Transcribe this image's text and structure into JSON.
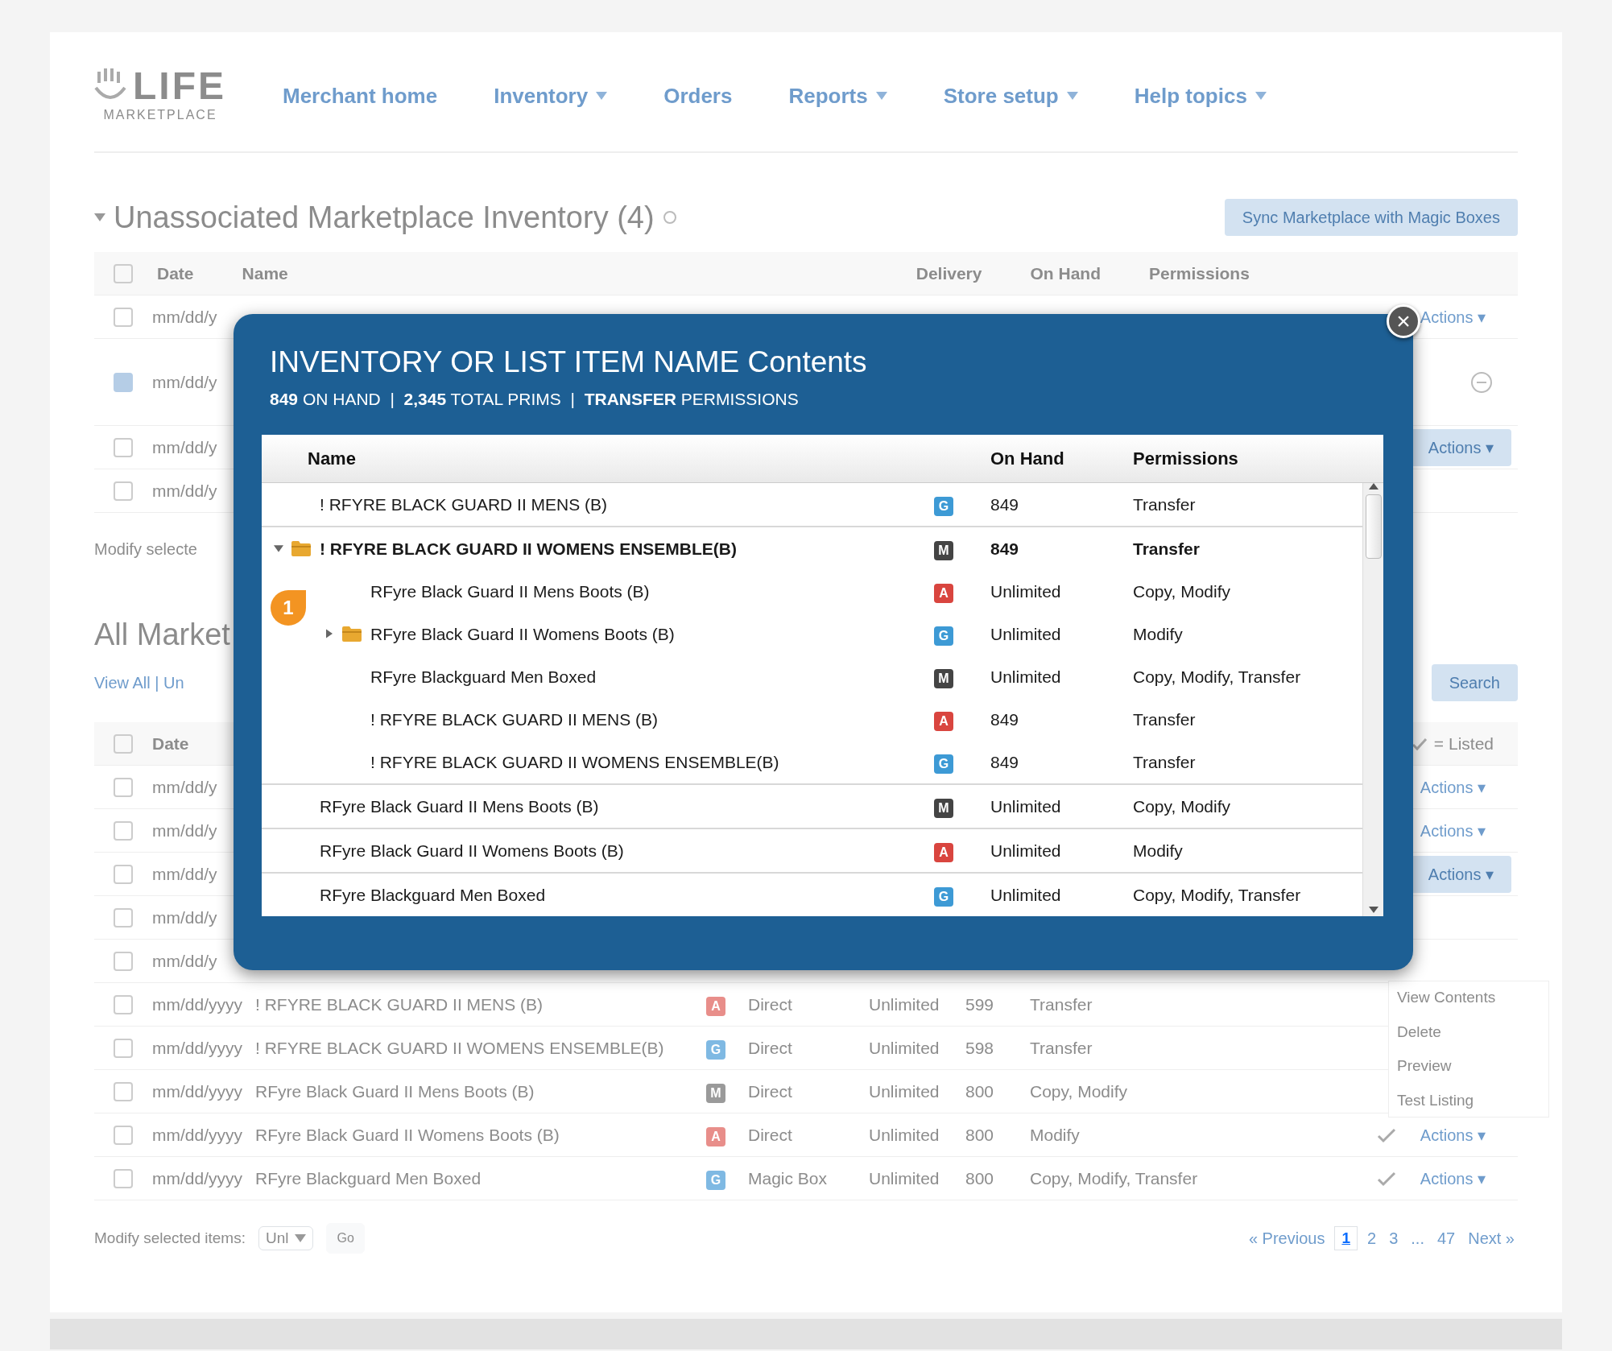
{
  "header": {
    "logo_main": "LIFE",
    "logo_sub": "MARKETPLACE",
    "nav": [
      {
        "label": "Merchant home",
        "dropdown": false
      },
      {
        "label": "Inventory",
        "dropdown": true
      },
      {
        "label": "Orders",
        "dropdown": false
      },
      {
        "label": "Reports",
        "dropdown": true
      },
      {
        "label": "Store setup",
        "dropdown": true
      },
      {
        "label": "Help topics",
        "dropdown": true
      }
    ]
  },
  "unassociated": {
    "title": "Unassociated Marketplace Inventory (4)",
    "expanded": true,
    "header_checked": false,
    "sync_button": "Sync Marketplace with Magic Boxes",
    "columns": [
      "Date",
      "Name",
      "Delivery",
      "On Hand",
      "Permissions"
    ],
    "rows": [
      {
        "date": "mm/dd/y",
        "checked": false,
        "kind": "link",
        "action_label": "Actions ▾"
      },
      {
        "date": "mm/dd/y",
        "checked": true,
        "kind": "icon"
      },
      {
        "date": "mm/dd/y",
        "checked": false,
        "kind": "button",
        "action_label": "Actions ▾"
      },
      {
        "date": "mm/dd/y",
        "checked": false,
        "kind": "plain"
      }
    ],
    "footer": "Modify selecte"
  },
  "all": {
    "title": "All Market",
    "view_links": "View All | Un",
    "search_button": "Search",
    "date_column": "Date",
    "header_checked": false,
    "listed_legend": "= Listed",
    "rows": [
      {
        "date": "mm/dd/y",
        "checked": false,
        "kind": "link",
        "action_label": "Actions ▾"
      },
      {
        "date": "mm/dd/y",
        "checked": false,
        "kind": "link",
        "action_label": "Actions ▾"
      },
      {
        "date": "mm/dd/y",
        "checked": false,
        "kind": "button",
        "action_label": "Actions ▾"
      },
      {
        "date": "mm/dd/y",
        "checked": false,
        "kind": "plain"
      },
      {
        "date": "mm/dd/y",
        "checked": false,
        "kind": "plain"
      }
    ],
    "full_rows": [
      {
        "checked": false,
        "date": "mm/dd/yyyy",
        "name": "! RFYRE BLACK GUARD II MENS (B)",
        "badge": {
          "text": "A",
          "color": "#e88e8a"
        },
        "delivery": "Direct",
        "on_hand": "Unlimited",
        "count": "599",
        "permissions": "Transfer",
        "listed": false
      },
      {
        "checked": false,
        "date": "mm/dd/yyyy",
        "name": "! RFYRE BLACK GUARD II WOMENS ENSEMBLE(B)",
        "badge": {
          "text": "G",
          "color": "#7fb9e3"
        },
        "delivery": "Direct",
        "on_hand": "Unlimited",
        "count": "598",
        "permissions": "Transfer",
        "listed": false
      },
      {
        "checked": false,
        "date": "mm/dd/yyyy",
        "name": "RFyre Black Guard II Mens Boots (B)",
        "badge": {
          "text": "M",
          "color": "#9a9a9a"
        },
        "delivery": "Direct",
        "on_hand": "Unlimited",
        "count": "800",
        "permissions": "Copy, Modify",
        "listed": false
      },
      {
        "checked": false,
        "date": "mm/dd/yyyy",
        "name": "RFyre Black Guard II Womens Boots (B)",
        "badge": {
          "text": "A",
          "color": "#e88e8a"
        },
        "delivery": "Direct",
        "on_hand": "Unlimited",
        "count": "800",
        "permissions": "Modify",
        "listed": true,
        "action_label": "Actions ▾"
      },
      {
        "checked": false,
        "date": "mm/dd/yyyy",
        "name": "RFyre Blackguard Men Boxed",
        "badge": {
          "text": "G",
          "color": "#7fb9e3"
        },
        "delivery": "Magic Box",
        "on_hand": "Unlimited",
        "count": "800",
        "permissions": "Copy, Modify, Transfer",
        "listed": true,
        "action_label": "Actions ▾"
      }
    ],
    "context_menu": [
      "View Contents",
      "Delete",
      "Preview",
      "Test Listing"
    ],
    "footer": {
      "label": "Modify selected items:",
      "select_value": "Unl",
      "go": "Go",
      "pages": [
        {
          "label": "« Previous",
          "selected": false
        },
        {
          "label": "1",
          "selected": true
        },
        {
          "label": "2",
          "selected": false
        },
        {
          "label": "3",
          "selected": false
        },
        {
          "label": "...",
          "selected": false
        },
        {
          "label": "47",
          "selected": false
        },
        {
          "label": "Next »",
          "selected": false
        }
      ]
    }
  },
  "modal": {
    "title": "INVENTORY OR LIST ITEM NAME Contents",
    "summary": "**849** ON HAND  |  **2,345** TOTAL PRIMS  |  **TRANSFER** PERMISSIONS",
    "close": "×",
    "marker": "1",
    "columns": [
      "Name",
      "On Hand",
      "Permissions"
    ],
    "rows": [
      {
        "kind": "item",
        "name": "! RFYRE BLACK GUARD II MENS (B)",
        "badge": {
          "text": "G",
          "color": "#3d9ad5"
        },
        "on_hand": "849",
        "permissions": "Transfer"
      },
      {
        "kind": "folder",
        "expanded": true,
        "name": "! RFYRE BLACK GUARD II WOMENS ENSEMBLE(B)",
        "badge": {
          "text": "M",
          "color": "#444444"
        },
        "on_hand": "849",
        "permissions": "Transfer",
        "children": [
          {
            "kind": "item",
            "name": "RFyre Black Guard II Mens Boots (B)",
            "badge": {
              "text": "A",
              "color": "#d9453f"
            },
            "on_hand": "Unlimited",
            "permissions": "Copy, Modify"
          },
          {
            "kind": "folder",
            "expanded": false,
            "name": "RFyre Black Guard II Womens Boots (B)",
            "badge": {
              "text": "G",
              "color": "#3d9ad5"
            },
            "on_hand": "Unlimited",
            "permissions": "Modify"
          },
          {
            "kind": "item",
            "name": "RFyre Blackguard Men Boxed",
            "badge": {
              "text": "M",
              "color": "#444444"
            },
            "on_hand": "Unlimited",
            "permissions": "Copy, Modify, Transfer"
          },
          {
            "kind": "item",
            "name": "! RFYRE BLACK GUARD II MENS (B)",
            "badge": {
              "text": "A",
              "color": "#d9453f"
            },
            "on_hand": "849",
            "permissions": "Transfer"
          },
          {
            "kind": "item",
            "name": "! RFYRE BLACK GUARD II WOMENS ENSEMBLE(B)",
            "badge": {
              "text": "G",
              "color": "#3d9ad5"
            },
            "on_hand": "849",
            "permissions": "Transfer"
          }
        ]
      },
      {
        "kind": "item",
        "name": "RFyre Black Guard II Mens Boots (B)",
        "badge": {
          "text": "M",
          "color": "#444444"
        },
        "on_hand": "Unlimited",
        "permissions": "Copy, Modify"
      },
      {
        "kind": "item",
        "name": "RFyre Black Guard II Womens Boots (B)",
        "badge": {
          "text": "A",
          "color": "#d9453f"
        },
        "on_hand": "Unlimited",
        "permissions": "Modify"
      },
      {
        "kind": "item",
        "name": "RFyre Blackguard Men Boxed",
        "badge": {
          "text": "G",
          "color": "#3d9ad5"
        },
        "on_hand": "Unlimited",
        "permissions": "Copy, Modify, Transfer"
      }
    ]
  }
}
